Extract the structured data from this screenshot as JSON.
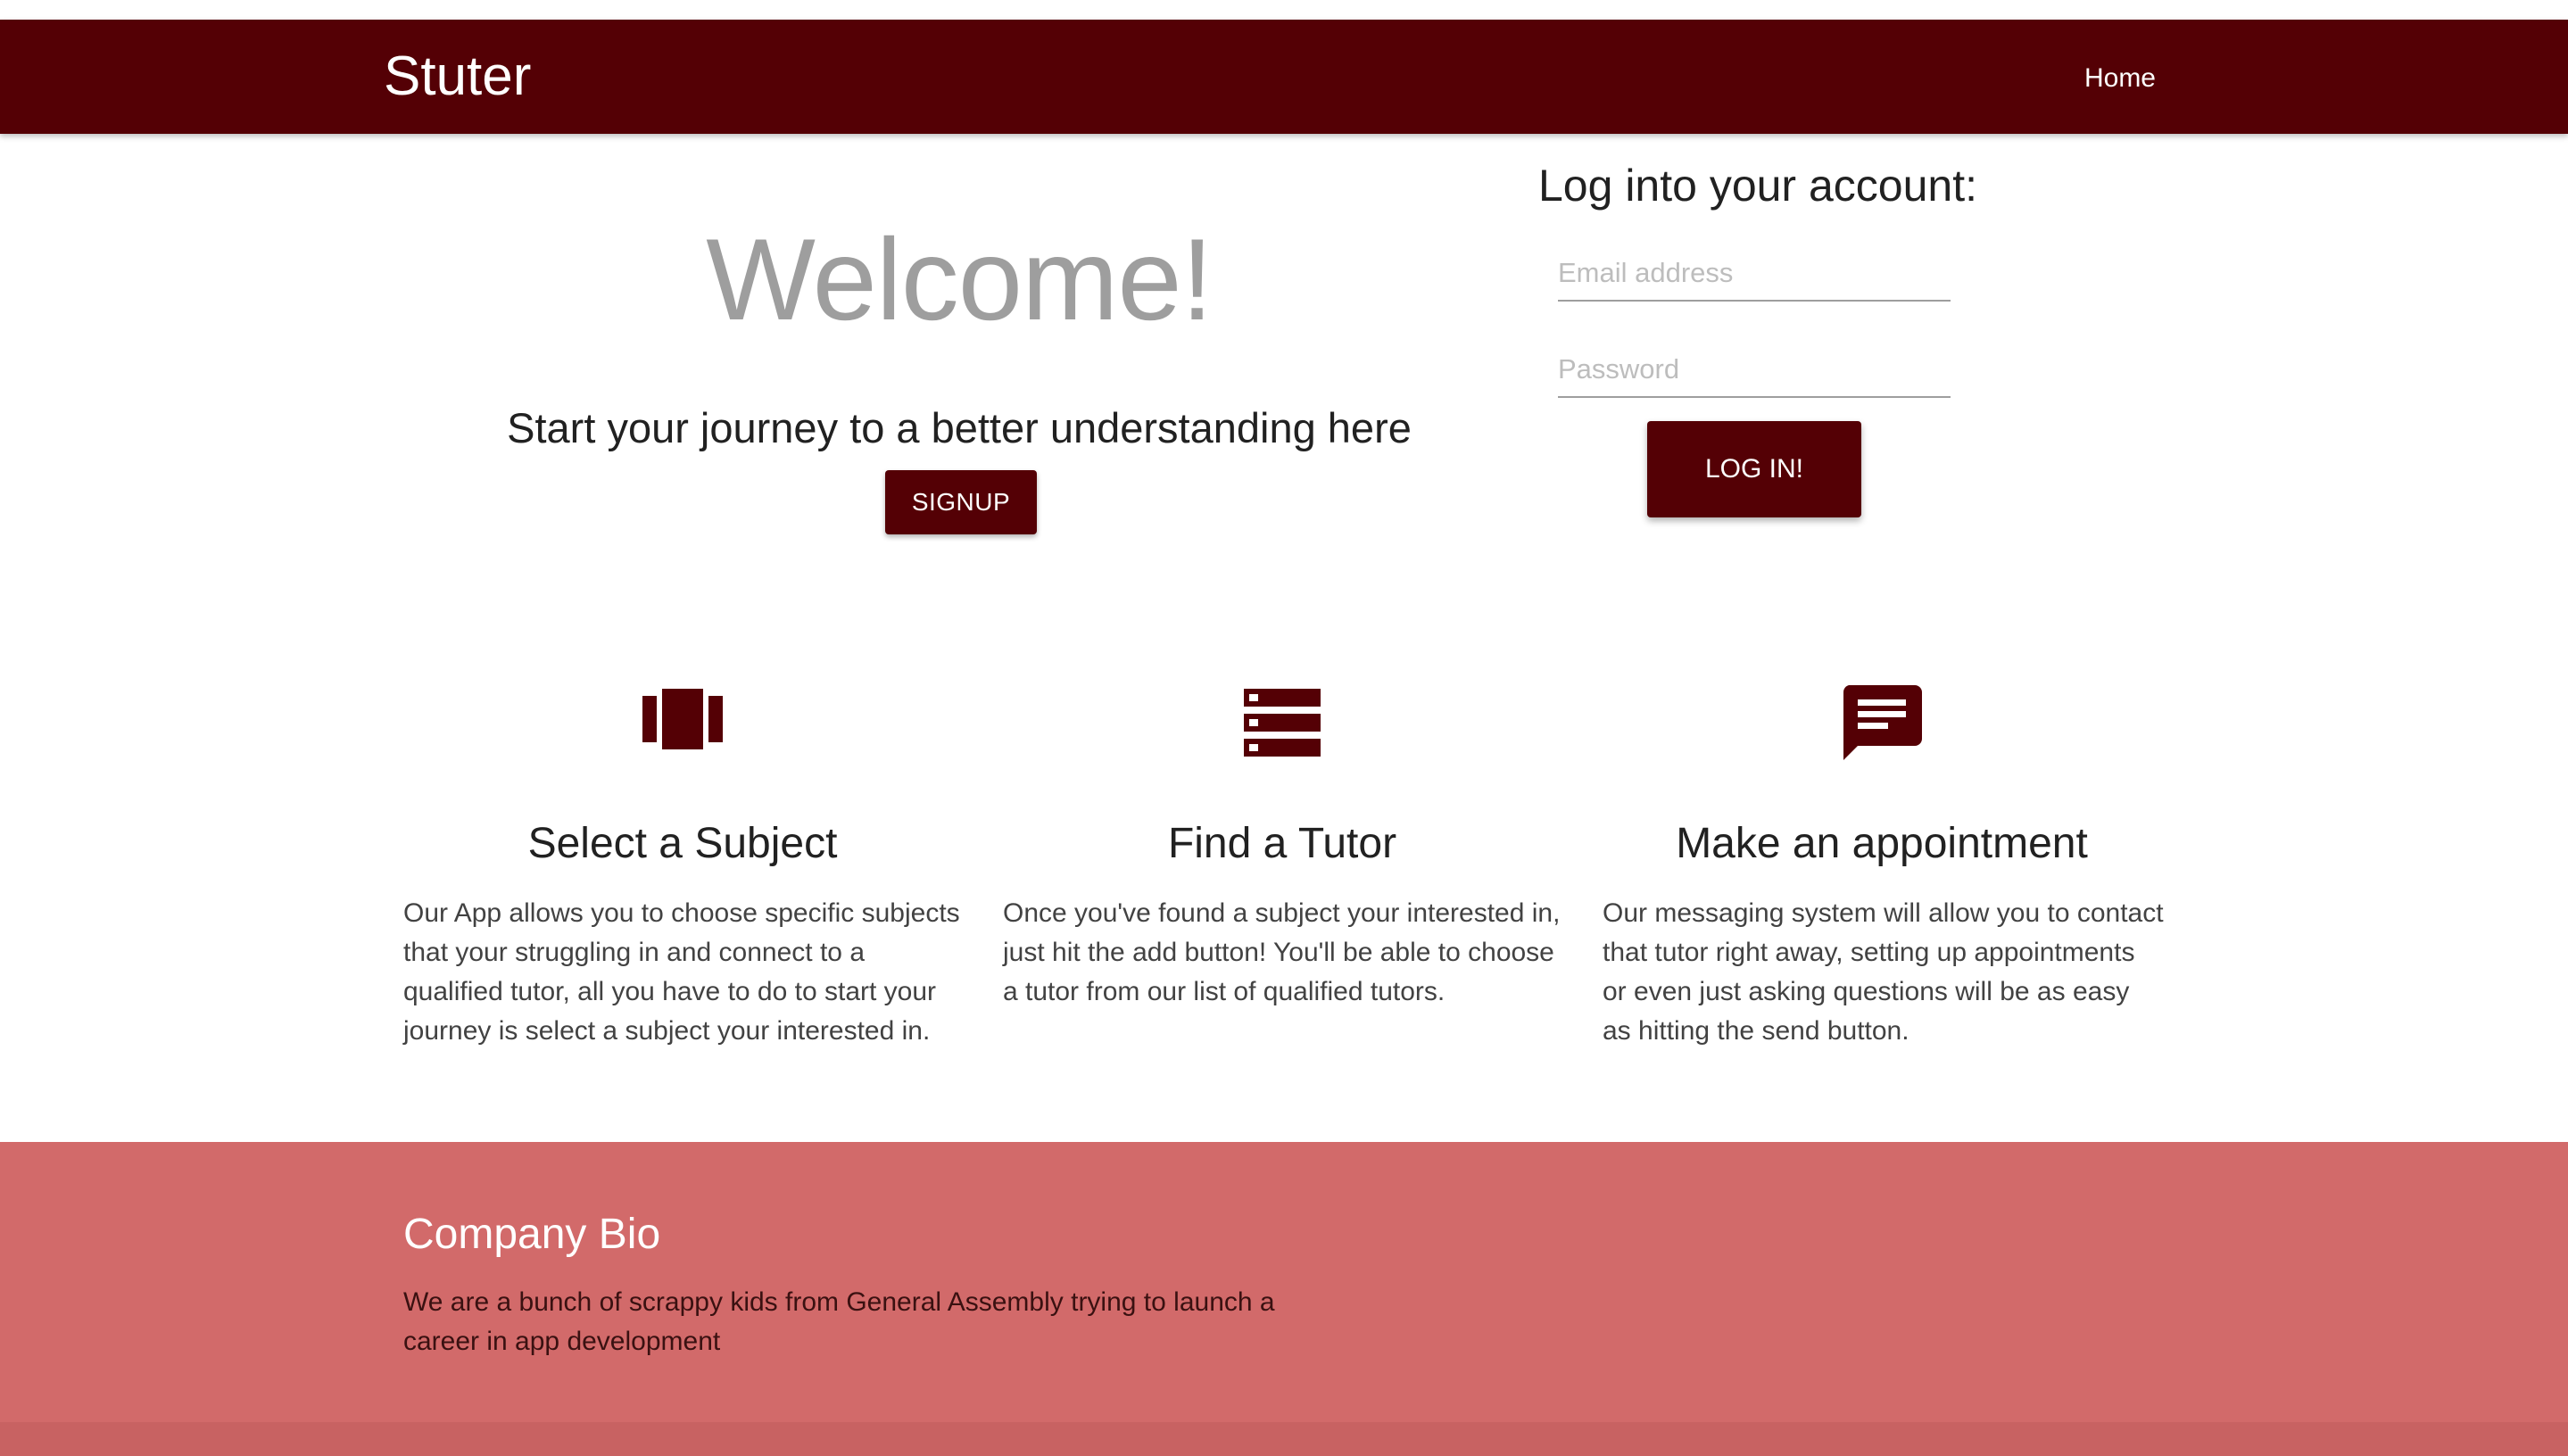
{
  "navbar": {
    "brand": "Stuter",
    "home_link": "Home"
  },
  "hero": {
    "welcome": "Welcome!",
    "subtitle": "Start your journey to a better understanding here",
    "signup_label": "SIGNUP"
  },
  "login": {
    "title": "Log into your account:",
    "email_placeholder": "Email address",
    "email_value": "",
    "password_placeholder": "Password",
    "password_value": "",
    "button_label": "LOG IN!"
  },
  "features": [
    {
      "icon": "view-carousel-icon",
      "title": "Select a Subject",
      "text": "Our App allows you to choose specific subjects that your struggling in and connect to a qualified tutor, all you have to do to start your journey is select a subject your interested in."
    },
    {
      "icon": "list-icon",
      "title": "Find a Tutor",
      "text": "Once you've found a subject your interested in, just hit the add button! You'll be able to choose a tutor from our list of qualified tutors."
    },
    {
      "icon": "message-icon",
      "title": "Make an appointment",
      "text": "Our messaging system will allow you to contact that tutor right away, setting up appointments or even just asking questions will be as easy as hitting the send button."
    }
  ],
  "footer": {
    "title": "Company Bio",
    "text": "We are a bunch of scrappy kids from General Assembly trying to launch a career in app development"
  },
  "colors": {
    "brand": "#540005",
    "footer": "#d26a6a",
    "welcome_text": "#9e9e9e"
  }
}
